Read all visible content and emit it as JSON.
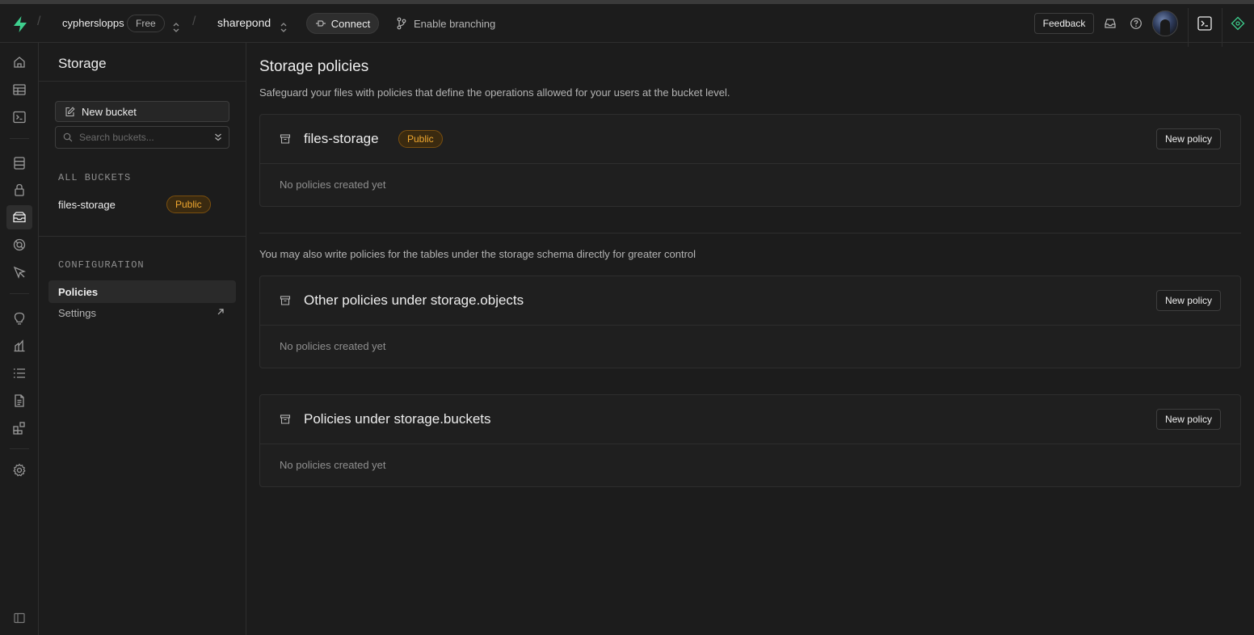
{
  "topbar": {
    "org_name": "cypherslopps",
    "plan": "Free",
    "project_name": "sharepond",
    "connect_label": "Connect",
    "branching_label": "Enable branching",
    "feedback_label": "Feedback"
  },
  "rail": {
    "items": [
      "home-icon",
      "table-editor-icon",
      "sql-editor-icon",
      "database-icon",
      "auth-icon",
      "storage-icon",
      "realtime-icon",
      "edge-functions-icon",
      "advisors-icon",
      "reports-icon",
      "logs-icon",
      "api-docs-icon",
      "integrations-icon",
      "settings-icon",
      "sidebar-toggle-icon"
    ],
    "active": "storage-icon"
  },
  "menu": {
    "title": "Storage",
    "new_bucket_label": "New bucket",
    "search_placeholder": "Search buckets...",
    "all_buckets_label": "ALL BUCKETS",
    "buckets": [
      {
        "name": "files-storage",
        "badge": "Public"
      }
    ],
    "configuration_label": "CONFIGURATION",
    "config_items": [
      {
        "label": "Policies",
        "active": true
      },
      {
        "label": "Settings",
        "external": true
      }
    ]
  },
  "main": {
    "title": "Storage policies",
    "description": "Safeguard your files with policies that define the operations allowed for your users at the bucket level.",
    "note": "You may also write policies for the tables under the storage schema directly for greater control",
    "cards": [
      {
        "title": "files-storage",
        "badge": "Public",
        "button": "New policy",
        "empty": "No policies created yet"
      },
      {
        "title": "Other policies under storage.objects",
        "button": "New policy",
        "empty": "No policies created yet"
      },
      {
        "title": "Policies under storage.buckets",
        "button": "New policy",
        "empty": "No policies created yet"
      }
    ]
  },
  "colors": {
    "background": "#1c1c1c",
    "brand": "#3ecf8e",
    "badge_public": "#f0a830"
  }
}
